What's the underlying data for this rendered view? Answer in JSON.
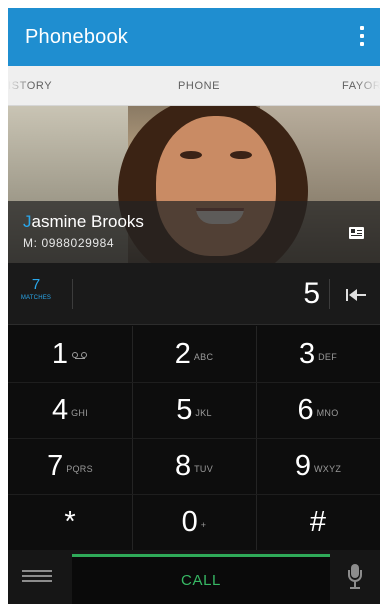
{
  "app": {
    "title": "Phonebook"
  },
  "tabs": [
    {
      "label": "ISTORY"
    },
    {
      "label": "PHONE",
      "selected": true
    },
    {
      "label": "FAYORI"
    }
  ],
  "contact": {
    "first_initial": "J",
    "name_rest": "asmine Brooks",
    "number": "M: 0988029984"
  },
  "dialer": {
    "matches_count": "7",
    "matches_label": "MATCHES",
    "typed_digits": "5"
  },
  "keypad": [
    {
      "digit": "1",
      "letters": "",
      "voicemail": true
    },
    {
      "digit": "2",
      "letters": "ABC"
    },
    {
      "digit": "3",
      "letters": "DEF"
    },
    {
      "digit": "4",
      "letters": "GHI"
    },
    {
      "digit": "5",
      "letters": "JKL"
    },
    {
      "digit": "6",
      "letters": "MNO"
    },
    {
      "digit": "7",
      "letters": "PQRS"
    },
    {
      "digit": "8",
      "letters": "TUV"
    },
    {
      "digit": "9",
      "letters": "WXYZ"
    },
    {
      "digit": "*",
      "letters": ""
    },
    {
      "digit": "0",
      "letters": "+"
    },
    {
      "digit": "#",
      "letters": ""
    }
  ],
  "bottom_bar": {
    "call_label": "CALL"
  },
  "icons": {
    "overflow": "overflow-menu-icon",
    "contact_card": "contact-card-icon",
    "backspace": "backspace-icon",
    "keyboard": "keyboard-icon",
    "microphone": "microphone-icon",
    "voicemail": "voicemail-icon"
  },
  "colors": {
    "app_bar": "#1f8ed0",
    "accent_blue": "#2aa8ec",
    "call_green": "#37b864",
    "keypad_bg": "#0d0d0d"
  }
}
